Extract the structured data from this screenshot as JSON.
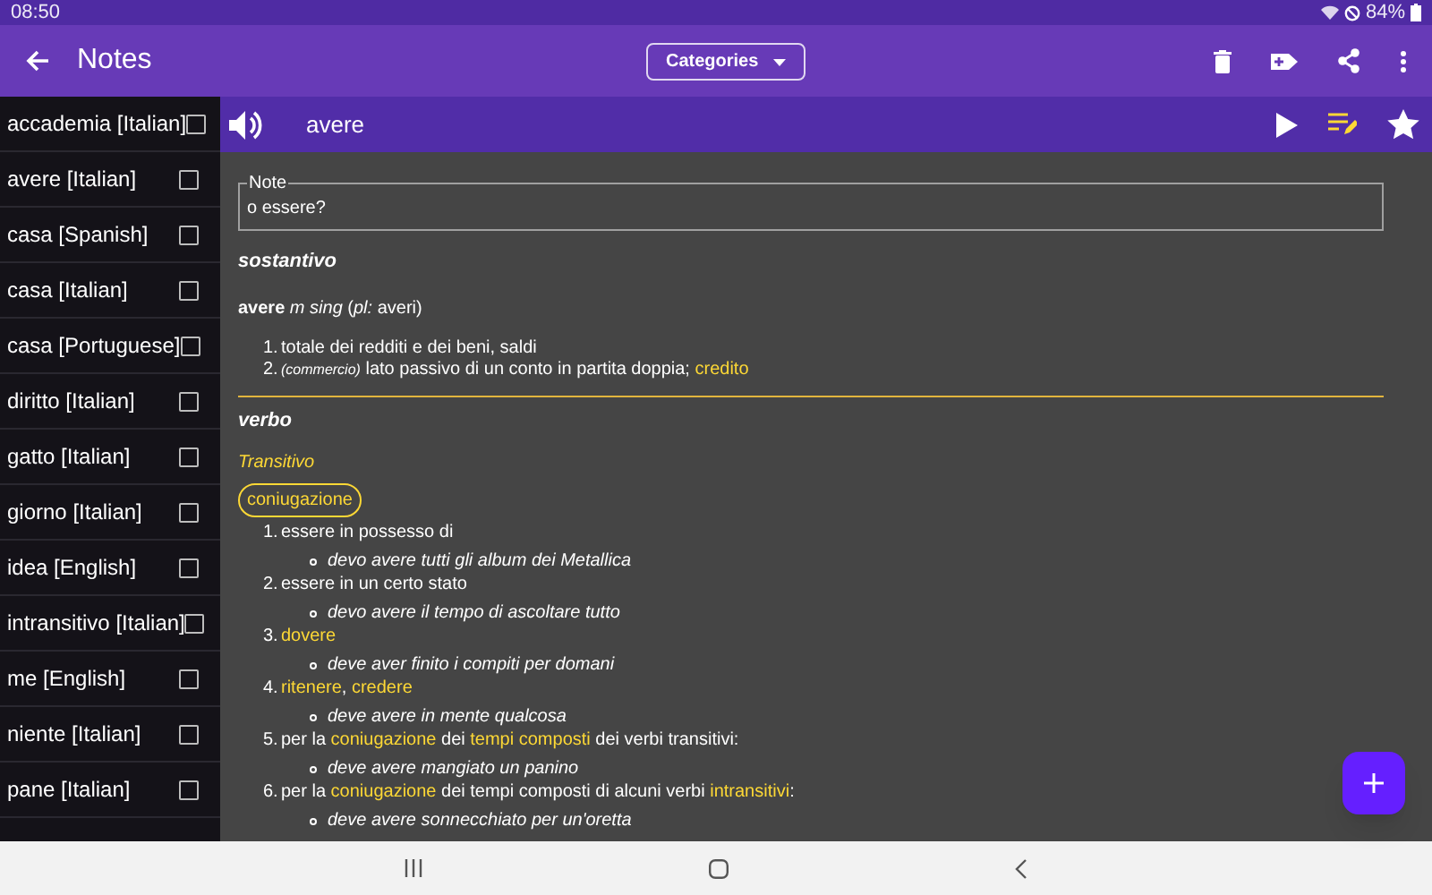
{
  "status_bar": {
    "time": "08:50",
    "battery": "84%"
  },
  "app_bar": {
    "title": "Notes",
    "categories_button": "Categories"
  },
  "sidebar": {
    "items": [
      {
        "label": "accademia [Italian]",
        "checked": false
      },
      {
        "label": "avere [Italian]",
        "checked": false
      },
      {
        "label": "casa [Spanish]",
        "checked": false
      },
      {
        "label": "casa [Italian]",
        "checked": false
      },
      {
        "label": "casa [Portuguese]",
        "checked": false
      },
      {
        "label": "diritto [Italian]",
        "checked": false
      },
      {
        "label": "gatto [Italian]",
        "checked": false
      },
      {
        "label": "giorno [Italian]",
        "checked": false
      },
      {
        "label": "idea [English]",
        "checked": false
      },
      {
        "label": "intransitivo [Italian]",
        "checked": false
      },
      {
        "label": "me [English]",
        "checked": false
      },
      {
        "label": "niente [Italian]",
        "checked": false
      },
      {
        "label": "pane [Italian]",
        "checked": false
      }
    ]
  },
  "word_bar": {
    "word": "avere"
  },
  "note": {
    "legend": "Note",
    "text": "o essere?"
  },
  "sections": [
    {
      "heading": "sostantivo",
      "headword": "**avere** *m sing* (*pl:* averi)",
      "senses": [
        {
          "number": "1.",
          "parts": [
            {
              "kind": "plain",
              "text": "totale dei redditi e dei beni, saldi"
            }
          ]
        },
        {
          "number": "2.",
          "parts": [
            {
              "kind": "small",
              "text": "(commercio)"
            },
            {
              "kind": "plain",
              "text": " lato passivo di un conto in partita doppia; "
            },
            {
              "kind": "link",
              "text": "credito"
            }
          ]
        }
      ]
    },
    {
      "heading": "verbo",
      "label": "Transitivo",
      "chip": "coniugazione",
      "senses": [
        {
          "number": "1.",
          "parts": [
            {
              "kind": "plain",
              "text": "essere in possesso di"
            }
          ],
          "examples": [
            "devo avere tutti gli album dei Metallica"
          ]
        },
        {
          "number": "2.",
          "parts": [
            {
              "kind": "plain",
              "text": "essere in un certo stato"
            }
          ],
          "examples": [
            "devo avere il tempo di ascoltare tutto"
          ]
        },
        {
          "number": "3.",
          "parts": [
            {
              "kind": "link",
              "text": "dovere"
            }
          ],
          "examples": [
            "deve aver finito i compiti per domani"
          ]
        },
        {
          "number": "4.",
          "parts": [
            {
              "kind": "link",
              "text": "ritenere"
            },
            {
              "kind": "plain",
              "text": ", "
            },
            {
              "kind": "link",
              "text": "credere"
            }
          ],
          "examples": [
            "deve avere in mente qualcosa"
          ]
        },
        {
          "number": "5.",
          "parts": [
            {
              "kind": "plain",
              "text": "per la "
            },
            {
              "kind": "link",
              "text": "coniugazione"
            },
            {
              "kind": "plain",
              "text": " dei "
            },
            {
              "kind": "link",
              "text": "tempi composti"
            },
            {
              "kind": "plain",
              "text": " dei verbi transitivi:"
            }
          ],
          "examples": [
            "deve avere mangiato un panino"
          ]
        },
        {
          "number": "6.",
          "parts": [
            {
              "kind": "plain",
              "text": "per la "
            },
            {
              "kind": "link",
              "text": "coniugazione"
            },
            {
              "kind": "plain",
              "text": " dei tempi composti di alcuni verbi "
            },
            {
              "kind": "link",
              "text": "intransitivi"
            },
            {
              "kind": "plain",
              "text": ":"
            }
          ],
          "examples": [
            "deve avere sonnecchiato per un'oretta"
          ]
        }
      ]
    }
  ]
}
